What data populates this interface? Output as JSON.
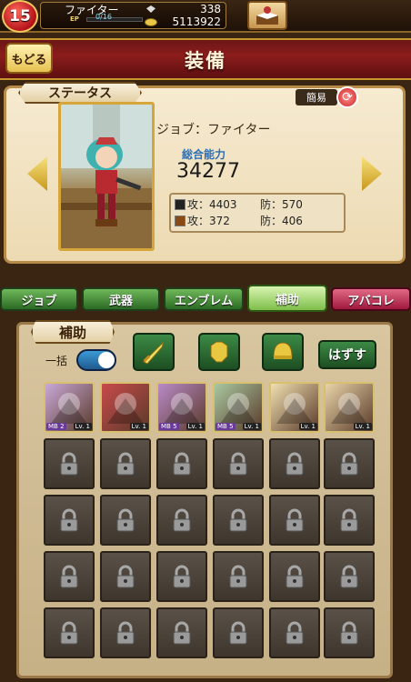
{
  "header": {
    "level": "15",
    "job_name": "ファイター",
    "ep_label": "EP",
    "ep_value": "0/16",
    "ep_progress": 0,
    "gems": "338",
    "gold": "5113922"
  },
  "title_bar": {
    "back_label": "もどる",
    "page_title": "装備"
  },
  "status": {
    "section_label": "ステータス",
    "simple_label": "簡易",
    "job_line": "ジョブ：ファイター",
    "power_label": "総合能力",
    "power_value": "34277",
    "attack1": "攻：4403",
    "defense1": "防：570",
    "attack2": "攻：372",
    "defense2": "防：406"
  },
  "tabs": [
    {
      "label": "ジョブ"
    },
    {
      "label": "武器"
    },
    {
      "label": "エンブレム"
    },
    {
      "label": "補助"
    },
    {
      "label": "アバコレ"
    }
  ],
  "support": {
    "section_label": "補助",
    "bulk_label": "一括",
    "remove_label": "はずす",
    "cards": [
      {
        "mb": "MB 2",
        "lv": "Lv. 1",
        "color": "#c9a8d8"
      },
      {
        "mb": "",
        "lv": "Lv. 1",
        "color": "#c84a4a"
      },
      {
        "mb": "MB 5",
        "lv": "Lv. 1",
        "color": "#b98ac8"
      },
      {
        "mb": "MB 5",
        "lv": "Lv. 1",
        "color": "#a8c8a0"
      },
      {
        "mb": "",
        "lv": "Lv. 1",
        "color": "#f0e0b0"
      },
      {
        "mb": "",
        "lv": "Lv. 1",
        "color": "#e8d4a8"
      }
    ]
  },
  "colors": {
    "title_red": "#8c1c1c",
    "tab_green": "#2b6a24",
    "tab_red": "#a0183c",
    "gold_border": "#c7962c"
  }
}
